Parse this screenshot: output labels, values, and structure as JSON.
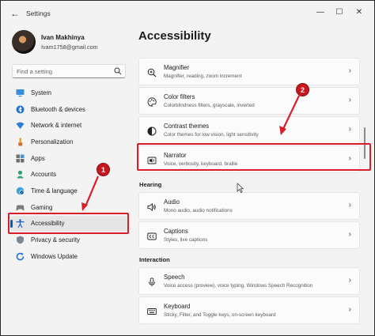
{
  "window": {
    "title": "Settings",
    "back_icon": "back-arrow-icon",
    "controls": [
      "minimize-icon",
      "maximize-icon",
      "close-icon"
    ]
  },
  "profile": {
    "name": "Ivan Makhinya",
    "email": "Ivam1758@gmail.com"
  },
  "search": {
    "placeholder": "Find a setting",
    "value": ""
  },
  "sidebar": {
    "items": [
      {
        "label": "System",
        "icon": "monitor-icon",
        "selected": false
      },
      {
        "label": "Bluetooth & devices",
        "icon": "bluetooth-icon",
        "selected": false
      },
      {
        "label": "Network & internet",
        "icon": "wifi-icon",
        "selected": false
      },
      {
        "label": "Personalization",
        "icon": "brush-icon",
        "selected": false
      },
      {
        "label": "Apps",
        "icon": "apps-icon",
        "selected": false
      },
      {
        "label": "Accounts",
        "icon": "person-icon",
        "selected": false
      },
      {
        "label": "Time & language",
        "icon": "globe-clock-icon",
        "selected": false
      },
      {
        "label": "Gaming",
        "icon": "gamepad-icon",
        "selected": false
      },
      {
        "label": "Accessibility",
        "icon": "accessibility-icon",
        "selected": true
      },
      {
        "label": "Privacy & security",
        "icon": "shield-icon",
        "selected": false
      },
      {
        "label": "Windows Update",
        "icon": "update-icon",
        "selected": false
      }
    ]
  },
  "main": {
    "title": "Accessibility",
    "cards": [
      {
        "title": "Magnifier",
        "subtitle": "Magnifier, reading, zoom increment",
        "icon": "magnifier-icon"
      },
      {
        "title": "Color filters",
        "subtitle": "Colorblindness filters, grayscale, inverted",
        "icon": "palette-icon"
      },
      {
        "title": "Contrast themes",
        "subtitle": "Color themes for low vision, light sensitivity",
        "icon": "contrast-icon"
      },
      {
        "title": "Narrator",
        "subtitle": "Voice, verbosity, keyboard, braille",
        "icon": "narrator-icon"
      }
    ],
    "sections": {
      "hearing": "Hearing",
      "interaction": "Interaction"
    },
    "hearing_cards": [
      {
        "title": "Audio",
        "subtitle": "Mono audio, audio notifications",
        "icon": "speaker-icon"
      },
      {
        "title": "Captions",
        "subtitle": "Styles, live captions",
        "icon": "captions-icon"
      }
    ],
    "interaction_cards": [
      {
        "title": "Speech",
        "subtitle": "Voice access (preview), voice typing, Windows Speech Recognition",
        "icon": "microphone-icon"
      },
      {
        "title": "Keyboard",
        "subtitle": "Sticky, Filter, and Toggle keys, on-screen keyboard",
        "icon": "keyboard-icon"
      }
    ]
  },
  "annotations": {
    "step1": "1",
    "step2": "2",
    "color": "#d81e28"
  }
}
